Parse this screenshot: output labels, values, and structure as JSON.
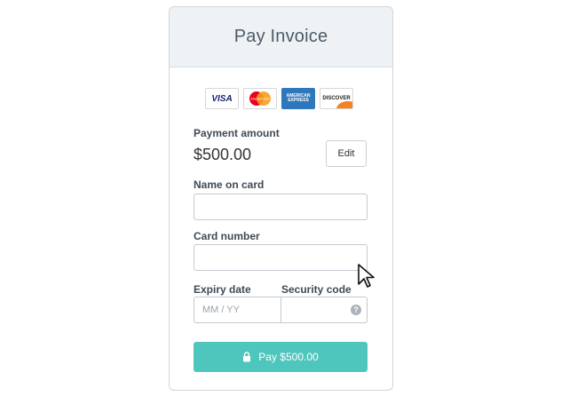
{
  "header": {
    "title": "Pay Invoice"
  },
  "card_logos": [
    {
      "name": "visa",
      "label": "VISA"
    },
    {
      "name": "mastercard",
      "label": "MasterCard"
    },
    {
      "name": "amex",
      "label": "AMERICAN EXPRESS"
    },
    {
      "name": "discover",
      "label": "DISCOVER"
    }
  ],
  "payment": {
    "label": "Payment amount",
    "amount": "$500.00",
    "edit_label": "Edit"
  },
  "fields": {
    "name_on_card": {
      "label": "Name on card",
      "value": "",
      "placeholder": ""
    },
    "card_number": {
      "label": "Card number",
      "value": "",
      "placeholder": ""
    },
    "expiry": {
      "label": "Expiry date",
      "value": "",
      "placeholder": "MM / YY"
    },
    "security_code": {
      "label": "Security code",
      "value": "",
      "placeholder": "",
      "help_icon": "?"
    }
  },
  "pay_button": {
    "label": "Pay $500.00",
    "icon": "lock-icon",
    "color": "#4fc6bd"
  },
  "icons": {
    "cursor": "mouse-pointer-icon"
  }
}
